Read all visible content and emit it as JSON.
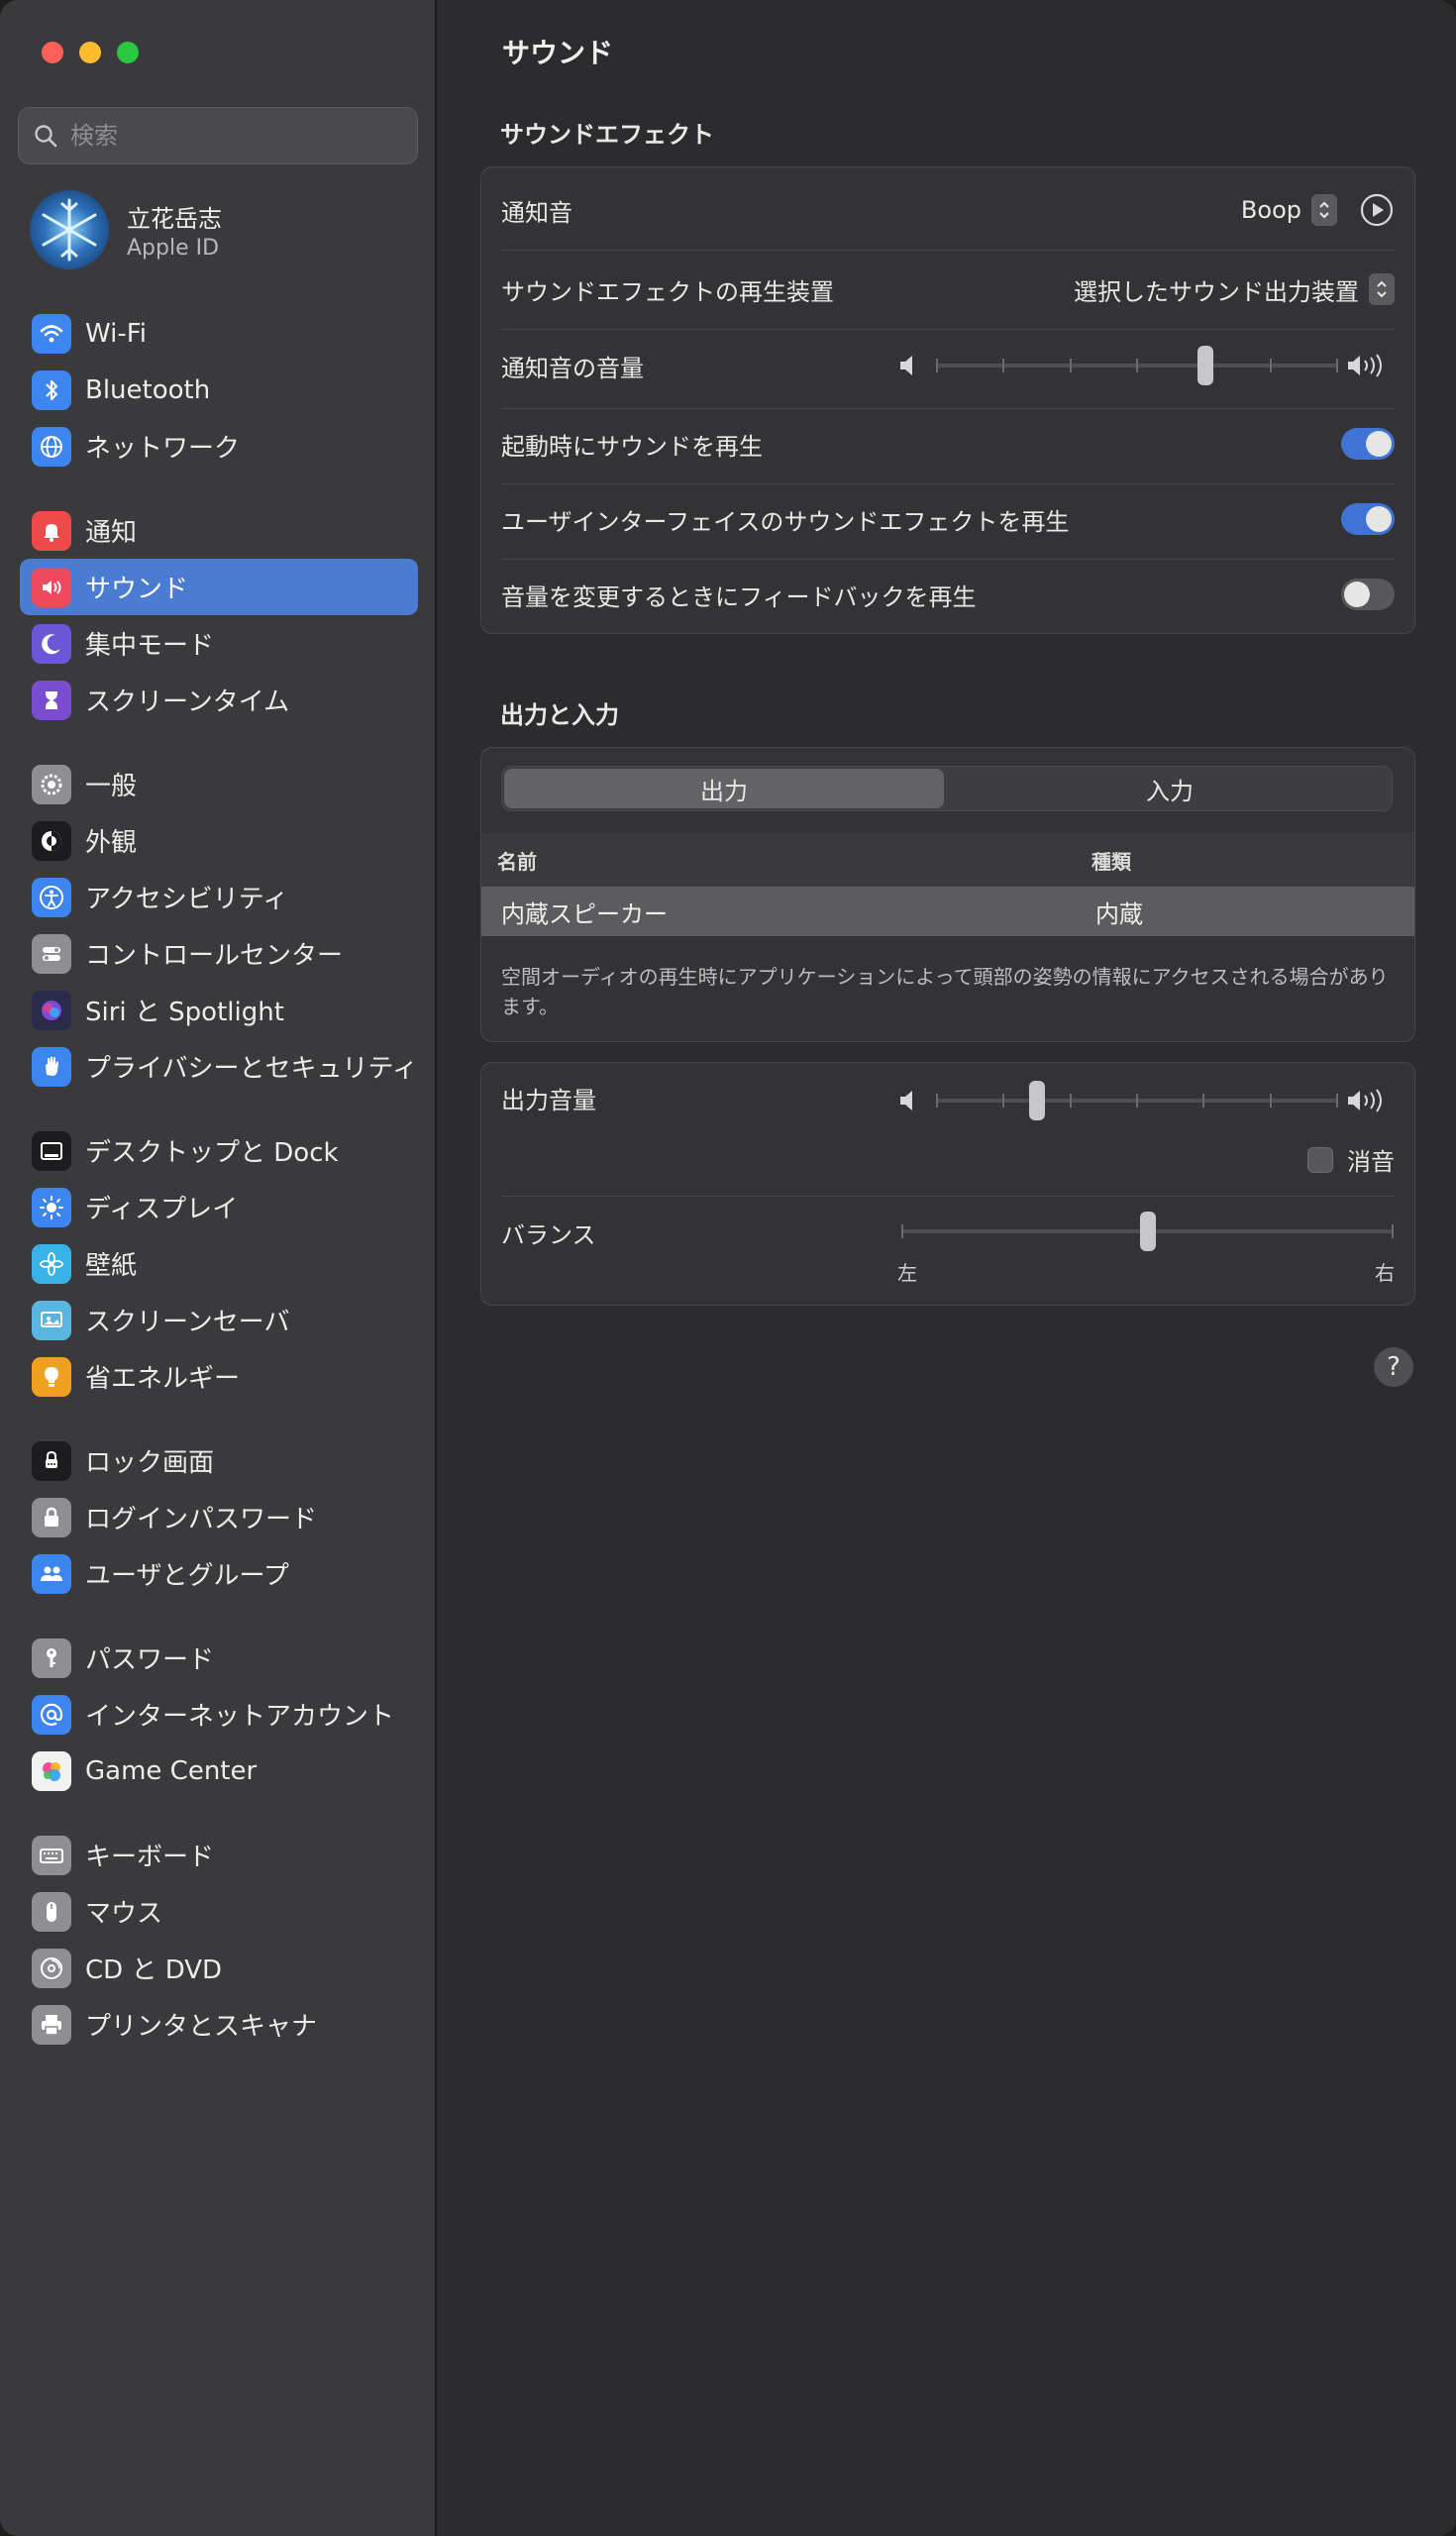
{
  "search": {
    "placeholder": "検索"
  },
  "account": {
    "name": "立花岳志",
    "subtitle": "Apple ID"
  },
  "sidebar": {
    "groups": [
      [
        {
          "label": "Wi-Fi",
          "icon": "wifi-icon",
          "color": "#3d86f0"
        },
        {
          "label": "Bluetooth",
          "icon": "bluetooth-icon",
          "color": "#3d86f0"
        },
        {
          "label": "ネットワーク",
          "icon": "globe-icon",
          "color": "#3d86f0"
        }
      ],
      [
        {
          "label": "通知",
          "icon": "bell-icon",
          "color": "#ee4a4a"
        },
        {
          "label": "サウンド",
          "icon": "speaker-icon",
          "color": "#ee4a5e",
          "selected": true
        },
        {
          "label": "集中モード",
          "icon": "moon-icon",
          "color": "#6b56d6"
        },
        {
          "label": "スクリーンタイム",
          "icon": "hourglass-icon",
          "color": "#7b4ccf"
        }
      ],
      [
        {
          "label": "一般",
          "icon": "gear-icon",
          "color": "#8e8e93"
        },
        {
          "label": "外観",
          "icon": "appearance-icon",
          "color": "#1c1c1e"
        },
        {
          "label": "アクセシビリティ",
          "icon": "accessibility-icon",
          "color": "#3d86f0"
        },
        {
          "label": "コントロールセンター",
          "icon": "toggles-icon",
          "color": "#8e8e93"
        },
        {
          "label": "Siri と Spotlight",
          "icon": "siri-icon",
          "color": "#2a2a4a"
        },
        {
          "label": "プライバシーとセキュリティ",
          "icon": "hand-icon",
          "color": "#3d86f0"
        }
      ],
      [
        {
          "label": "デスクトップと Dock",
          "icon": "dock-icon",
          "color": "#1c1c1e"
        },
        {
          "label": "ディスプレイ",
          "icon": "sun-icon",
          "color": "#3d86f0"
        },
        {
          "label": "壁紙",
          "icon": "flower-icon",
          "color": "#3ab0e8"
        },
        {
          "label": "スクリーンセーバ",
          "icon": "screensaver-icon",
          "color": "#5ab6e0"
        },
        {
          "label": "省エネルギー",
          "icon": "bulb-icon",
          "color": "#f0a020"
        }
      ],
      [
        {
          "label": "ロック画面",
          "icon": "lock-screen-icon",
          "color": "#1c1c1e"
        },
        {
          "label": "ログインパスワード",
          "icon": "lock-icon",
          "color": "#8e8e93"
        },
        {
          "label": "ユーザとグループ",
          "icon": "users-icon",
          "color": "#3d86f0"
        }
      ],
      [
        {
          "label": "パスワード",
          "icon": "key-icon",
          "color": "#8e8e93"
        },
        {
          "label": "インターネットアカウント",
          "icon": "at-icon",
          "color": "#3d86f0"
        },
        {
          "label": "Game Center",
          "icon": "game-center-icon",
          "color": "#f2f2f2"
        }
      ],
      [
        {
          "label": "キーボード",
          "icon": "keyboard-icon",
          "color": "#8e8e93"
        },
        {
          "label": "マウス",
          "icon": "mouse-icon",
          "color": "#8e8e93"
        },
        {
          "label": "CD と DVD",
          "icon": "disc-icon",
          "color": "#8e8e93"
        },
        {
          "label": "プリンタとスキャナ",
          "icon": "printer-icon",
          "color": "#8e8e93"
        }
      ]
    ]
  },
  "main": {
    "title": "サウンド",
    "effects": {
      "title": "サウンドエフェクト",
      "alert_sound_label": "通知音",
      "alert_sound_value": "Boop",
      "device_label": "サウンドエフェクトの再生装置",
      "device_value": "選択したサウンド出力装置",
      "alert_volume_label": "通知音の音量",
      "alert_volume_level": 0.67,
      "startup_label": "起動時にサウンドを再生",
      "startup_on": true,
      "ui_label": "ユーザインターフェイスのサウンドエフェクトを再生",
      "ui_on": true,
      "feedback_label": "音量を変更するときにフィードバックを再生",
      "feedback_on": false
    },
    "io": {
      "title": "出力と入力",
      "tab_output": "出力",
      "tab_input": "入力",
      "col_name": "名前",
      "col_type": "種類",
      "device_name": "内蔵スピーカー",
      "device_type": "内蔵",
      "note": "空間オーディオの再生時にアプリケーションによって頭部の姿勢の情報にアクセスされる場合があります。"
    },
    "output": {
      "volume_label": "出力音量",
      "volume_level": 0.25,
      "mute_label": "消音",
      "balance_label": "バランス",
      "balance_level": 0.5,
      "left_label": "左",
      "right_label": "右"
    },
    "help": "?"
  },
  "colors": {
    "accent": "#3f74d6",
    "selected": "#4a7dd1"
  }
}
